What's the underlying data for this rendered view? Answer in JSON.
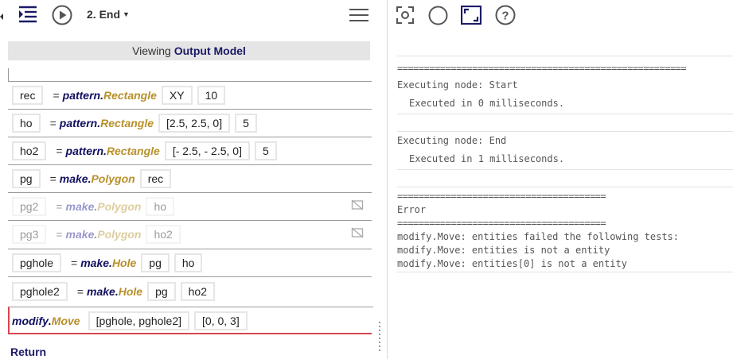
{
  "toolbar_left": {
    "node_label": "2. End",
    "icons": [
      "indent-icon",
      "play-icon",
      "hamburger-menu-icon"
    ]
  },
  "viewing": {
    "prefix": "Viewing",
    "model": "Output Model"
  },
  "procedure": [
    {
      "var": "rec",
      "module": "pattern",
      "func": "Rectangle",
      "args": [
        "XY",
        "10"
      ],
      "disabled": false
    },
    {
      "var": "ho",
      "module": "pattern",
      "func": "Rectangle",
      "args": [
        "[2.5, 2.5, 0]",
        "5"
      ],
      "disabled": false
    },
    {
      "var": "ho2",
      "module": "pattern",
      "func": "Rectangle",
      "args": [
        "[- 2.5, - 2.5, 0]",
        "5"
      ],
      "disabled": false
    },
    {
      "var": "pg",
      "module": "make",
      "func": "Polygon",
      "args": [
        "rec"
      ],
      "disabled": false
    },
    {
      "var": "pg2",
      "module": "make",
      "func": "Polygon",
      "args": [
        "ho"
      ],
      "disabled": true
    },
    {
      "var": "pg3",
      "module": "make",
      "func": "Polygon",
      "args": [
        "ho2"
      ],
      "disabled": true
    },
    {
      "var": "pghole",
      "module": "make",
      "func": "Hole",
      "args": [
        "pg",
        "ho"
      ],
      "disabled": false
    },
    {
      "var": "pghole2",
      "module": "make",
      "func": "Hole",
      "args": [
        "pg",
        "ho2"
      ],
      "disabled": false
    }
  ],
  "active_statement": {
    "module": "modify",
    "func": "Move",
    "args": [
      "[pghole, pghole2]",
      "[0, 0, 3]"
    ]
  },
  "return_label": "Return",
  "toolbar_right": {
    "icons": [
      "focus-icon",
      "circle-icon",
      "fit-screen-icon",
      "help-icon"
    ]
  },
  "console": {
    "sep_long": "======================================================",
    "exec_start": "Executing node: Start",
    "exec_start_time": "Executed in 0 milliseconds.",
    "exec_end": "Executing node: End",
    "exec_end_time": "Executed in 1 milliseconds.",
    "sep_short": "=======================================",
    "error": "Error",
    "err1": "modify.Move: entities failed the following tests:",
    "err2": "modify.Move: entities is not a entity",
    "err3": "modify.Move: entities[0] is not a entity"
  },
  "colors": {
    "module": "#101060",
    "function": "#b8902a",
    "active": "#d9464f"
  }
}
